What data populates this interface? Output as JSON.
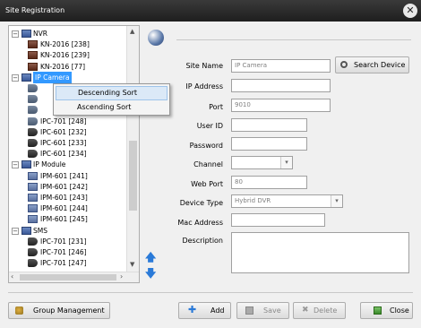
{
  "window": {
    "title": "Site Registration",
    "close_glyph": "✕"
  },
  "tree": {
    "rows": [
      {
        "label": "NVR",
        "icon": "folder",
        "exp": "−"
      },
      {
        "label": "KN-2016 [238]",
        "icon": "nvr"
      },
      {
        "label": "KN-2016 [239]",
        "icon": "nvr"
      },
      {
        "label": "KN-2016 [77]",
        "icon": "nvr"
      },
      {
        "label": "IP Camera",
        "icon": "folder",
        "exp": "−",
        "selected": true
      },
      {
        "label": "",
        "icon": "cam"
      },
      {
        "label": "",
        "icon": "cam"
      },
      {
        "label": "",
        "icon": "cam"
      },
      {
        "label": "IPC-701 [248]",
        "icon": "cam"
      },
      {
        "label": "IPC-601 [232]",
        "icon": "sms"
      },
      {
        "label": "IPC-601 [233]",
        "icon": "sms"
      },
      {
        "label": "IPC-601 [234]",
        "icon": "sms"
      },
      {
        "label": "IP Module",
        "icon": "folder",
        "exp": "−"
      },
      {
        "label": "IPM-601 [241]",
        "icon": "mod"
      },
      {
        "label": "IPM-601 [242]",
        "icon": "mod"
      },
      {
        "label": "IPM-601 [243]",
        "icon": "mod"
      },
      {
        "label": "IPM-601 [244]",
        "icon": "mod"
      },
      {
        "label": "IPM-601 [245]",
        "icon": "mod"
      },
      {
        "label": "SMS",
        "icon": "folder",
        "exp": "−"
      },
      {
        "label": "IPC-701 [231]",
        "icon": "sms"
      },
      {
        "label": "IPC-701 [246]",
        "icon": "sms"
      },
      {
        "label": "IPC-701 [247]",
        "icon": "sms"
      }
    ]
  },
  "context_menu": {
    "items": [
      "Descending Sort",
      "Ascending Sort"
    ]
  },
  "form": {
    "site_name_label": "Site Name",
    "site_name_value": "IP Camera",
    "ip_label": "IP Address",
    "ip_value": "",
    "port_label": "Port",
    "port_value": "9010",
    "user_label": "User ID",
    "user_value": "",
    "password_label": "Password",
    "password_value": "",
    "channel_label": "Channel",
    "channel_value": "",
    "webport_label": "Web Port",
    "webport_value": "80",
    "device_type_label": "Device Type",
    "device_type_value": "Hybrid DVR",
    "mac_label": "Mac Address",
    "mac_value": "",
    "description_label": "Description",
    "description_value": ""
  },
  "buttons": {
    "search_device": "Search Device",
    "group_management": "Group Management",
    "add": "Add",
    "save": "Save",
    "delete": "Delete",
    "close": "Close"
  }
}
